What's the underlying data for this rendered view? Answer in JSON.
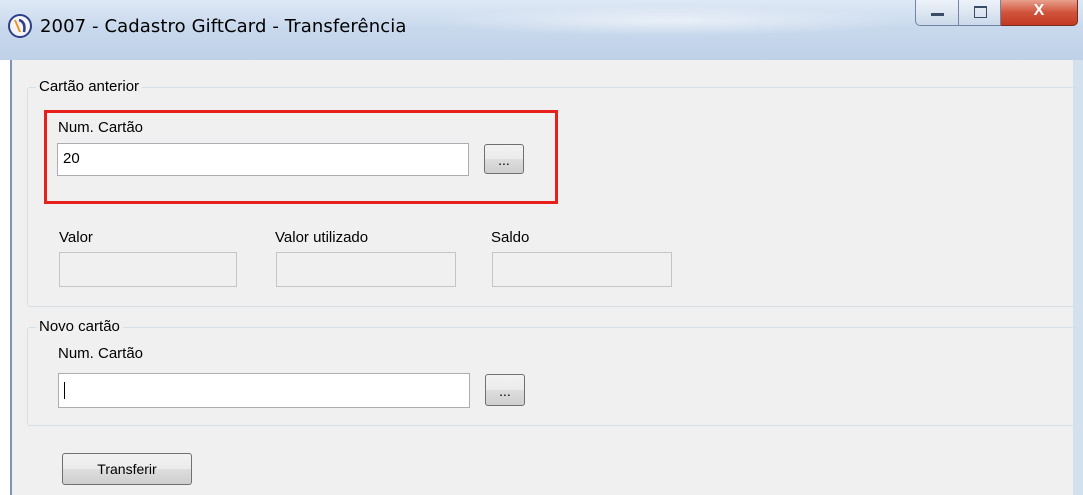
{
  "window": {
    "title": "2007 - Cadastro GiftCard - Transferência",
    "icon": "app-logo-icon",
    "close_glyph": "X",
    "colors": {
      "close": "#c33a22",
      "highlight": "#e8201c",
      "titlebar": "#c9d9ed"
    }
  },
  "cartao_anterior": {
    "group_title": "Cartão anterior",
    "num_cartao_label": "Num. Cartão",
    "num_cartao_value": "20",
    "lookup_label": "...",
    "valor_label": "Valor",
    "valor_value": "",
    "valor_utilizado_label": "Valor utilizado",
    "valor_utilizado_value": "",
    "saldo_label": "Saldo",
    "saldo_value": ""
  },
  "novo_cartao": {
    "group_title": "Novo cartão",
    "num_cartao_label": "Num. Cartão",
    "num_cartao_value": "",
    "lookup_label": "..."
  },
  "actions": {
    "transferir_label": "Transferir"
  }
}
